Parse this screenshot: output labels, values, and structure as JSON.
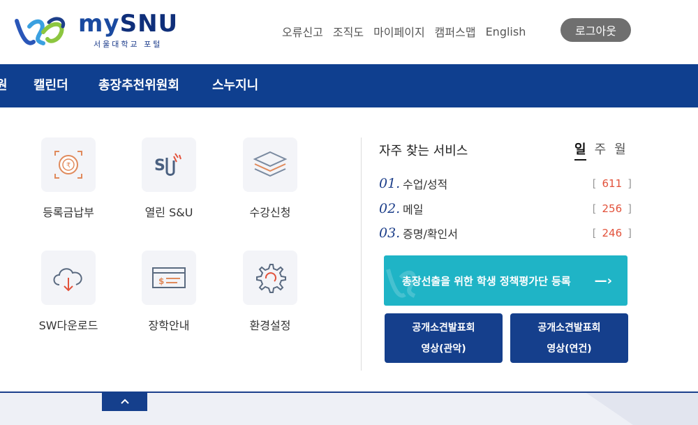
{
  "logo": {
    "brand_my": "my",
    "brand_snu": "SNU",
    "subtitle": "서울대학교 포털"
  },
  "util_links": [
    "오류신고",
    "조직도",
    "마이페이지",
    "캠퍼스맵",
    "English"
  ],
  "logout_label": "로그아웃",
  "nav": {
    "partial": "원",
    "items": [
      "캘린더",
      "총장추천위원회",
      "스누지니"
    ]
  },
  "quick": [
    {
      "label": "등록금납부",
      "icon": "payment-icon"
    },
    {
      "label": "열린 S&U",
      "icon": "snu-open-icon"
    },
    {
      "label": "수강신청",
      "icon": "layers-icon"
    },
    {
      "label": "SW다운로드",
      "icon": "cloud-download-icon"
    },
    {
      "label": "장학안내",
      "icon": "scholarship-card-icon"
    },
    {
      "label": "환경설정",
      "icon": "settings-gear-icon"
    }
  ],
  "services": {
    "title": "자주 찾는 서비스",
    "tabs": [
      "일",
      "주",
      "월"
    ],
    "active_tab": "일",
    "items": [
      {
        "num": "01.",
        "name": "수업/성적",
        "count": "611"
      },
      {
        "num": "02.",
        "name": "메일",
        "count": "256"
      },
      {
        "num": "03.",
        "name": "증명/확인서",
        "count": "246"
      }
    ]
  },
  "banner": {
    "text": "총장선출을 위한 학생 정책평가단 등록",
    "arrow": "—›"
  },
  "video_buttons": [
    {
      "line1": "공개소견발표회",
      "line2": "영상(관악)"
    },
    {
      "line1": "공개소견발표회",
      "line2": "영상(연건)"
    }
  ],
  "bottom_toggle": "^",
  "colors": {
    "nav_bg": "#0f3f8f",
    "banner_bg": "#1fb4c6",
    "button_bg": "#153f8c",
    "count_red": "#e2523b"
  }
}
